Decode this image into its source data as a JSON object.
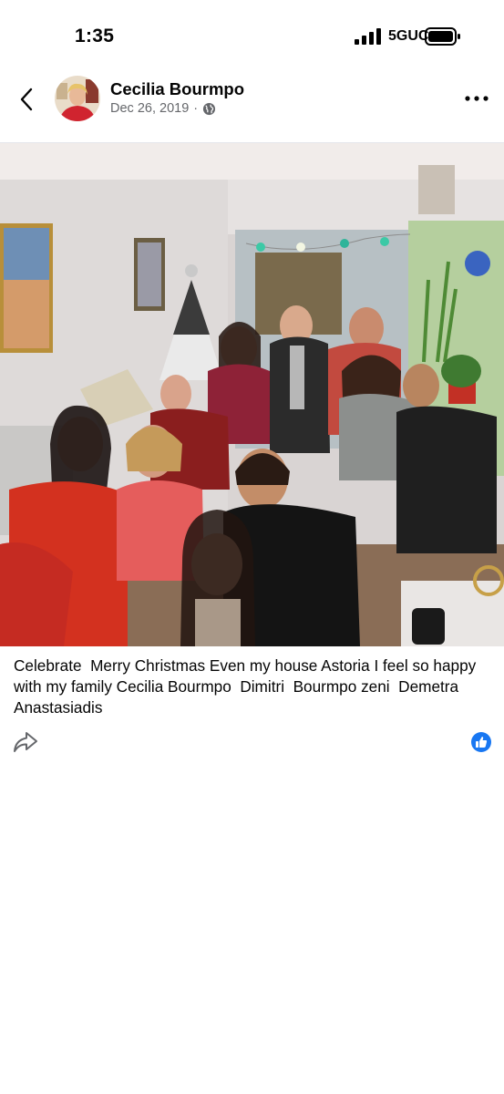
{
  "status_bar": {
    "time": "1:35",
    "network": "5GUC",
    "icons": [
      "signal-bars-icon",
      "battery-icon"
    ]
  },
  "post": {
    "author": "Cecilia Bourmpo",
    "date": "Dec 26, 2019",
    "separator": "·",
    "audience_icon": "globe-icon",
    "caption": "Celebrate  Merry Christmas Even my house Astoria I feel so happy with my family Cecilia Bourmpo  Dimitri  Bourmpo zeni  Demetra  Anastasiadis"
  },
  "actions": {
    "share_icon": "share-arrow-icon",
    "reaction_icon": "like-thumb-icon"
  },
  "colors": {
    "facebook_blue": "#1877f2",
    "meta_gray": "#65676b",
    "text": "#050505"
  }
}
